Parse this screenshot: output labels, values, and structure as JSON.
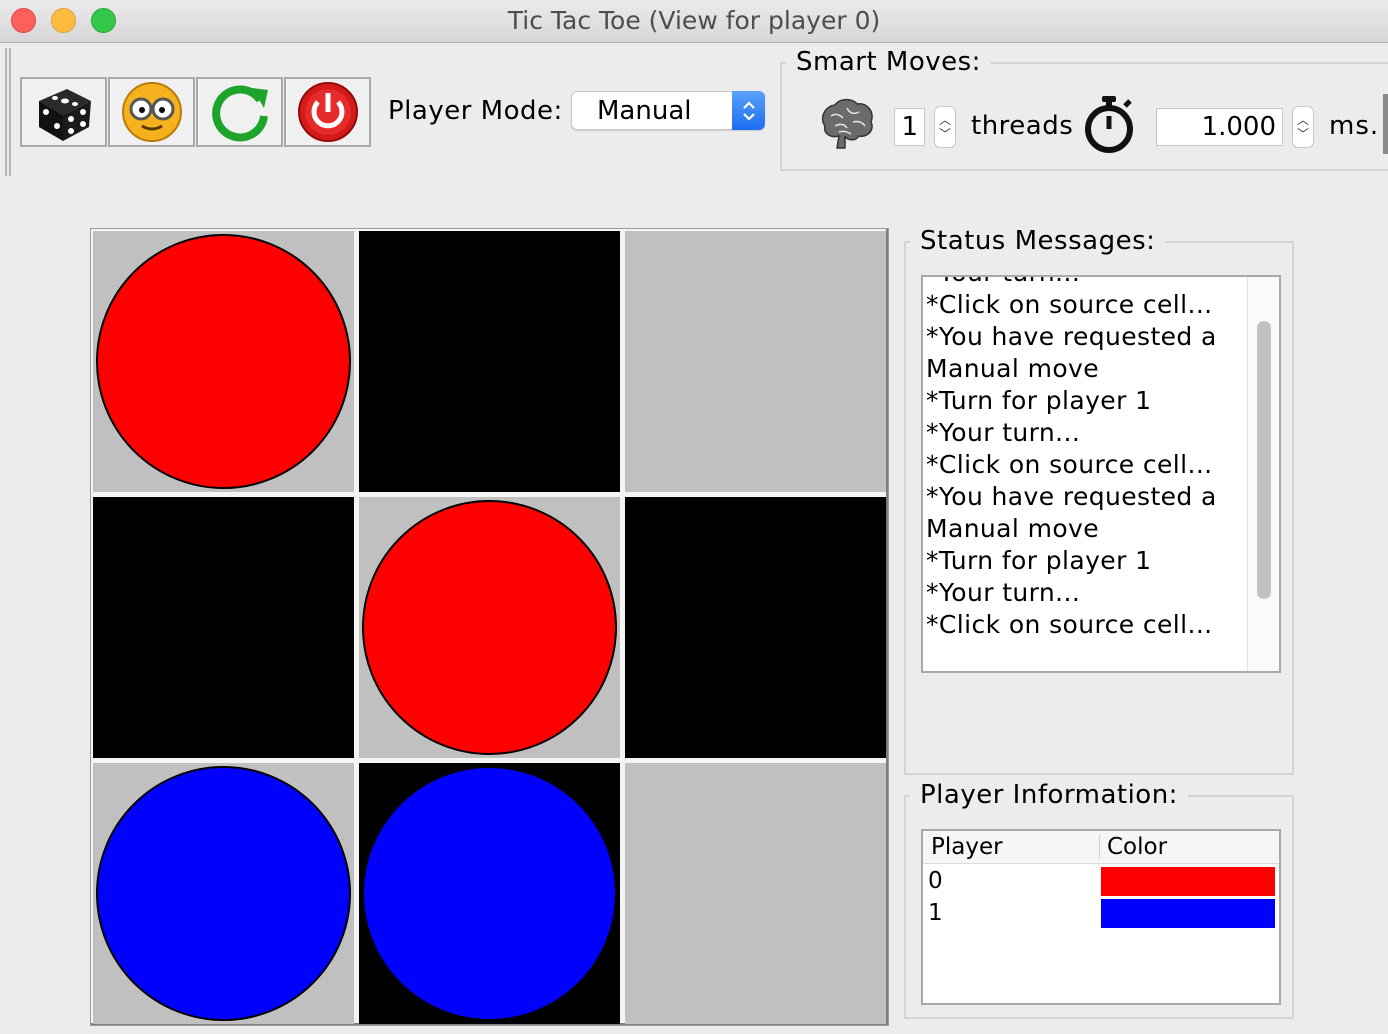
{
  "window": {
    "title": "Tic Tac Toe (View for player 0)"
  },
  "toolbar": {
    "buttons": [
      {
        "icon": "dice-icon"
      },
      {
        "icon": "smiley-glasses-icon"
      },
      {
        "icon": "refresh-icon"
      },
      {
        "icon": "power-icon"
      }
    ],
    "player_mode_label": "Player Mode:",
    "player_mode_value": "Manual"
  },
  "smart_moves": {
    "title": "Smart Moves:",
    "threads_value": "1",
    "threads_label": "threads",
    "time_value": "1.000",
    "time_unit": "ms.",
    "icons": [
      "brain-icon",
      "stopwatch-icon"
    ]
  },
  "board": {
    "rows": 3,
    "cols": 3,
    "cell_colors": [
      [
        "light",
        "dark",
        "light"
      ],
      [
        "dark",
        "light",
        "dark"
      ],
      [
        "light",
        "dark",
        "light"
      ]
    ],
    "pieces": [
      [
        "red",
        null,
        null
      ],
      [
        null,
        "red",
        null
      ],
      [
        "blue",
        "blue",
        null
      ]
    ],
    "colors": {
      "light": "#c0c0c0",
      "dark": "#000000",
      "red": "#ff0000",
      "blue": "#0000ff"
    }
  },
  "status": {
    "title": "Status Messages:",
    "messages": [
      "*Your turn...",
      "*Click on source cell...",
      "*You have requested a",
      "Manual move",
      "*Turn for player 1",
      "*Your turn...",
      "*Click on source cell...",
      "*You have requested a",
      "Manual move",
      "*Turn for player 1",
      "*Your turn...",
      "*Click on source cell..."
    ]
  },
  "player_info": {
    "title": "Player Information:",
    "headers": [
      "Player",
      "Color"
    ],
    "rows": [
      {
        "player": "0",
        "color": "#ff0000"
      },
      {
        "player": "1",
        "color": "#0000ff"
      }
    ]
  }
}
